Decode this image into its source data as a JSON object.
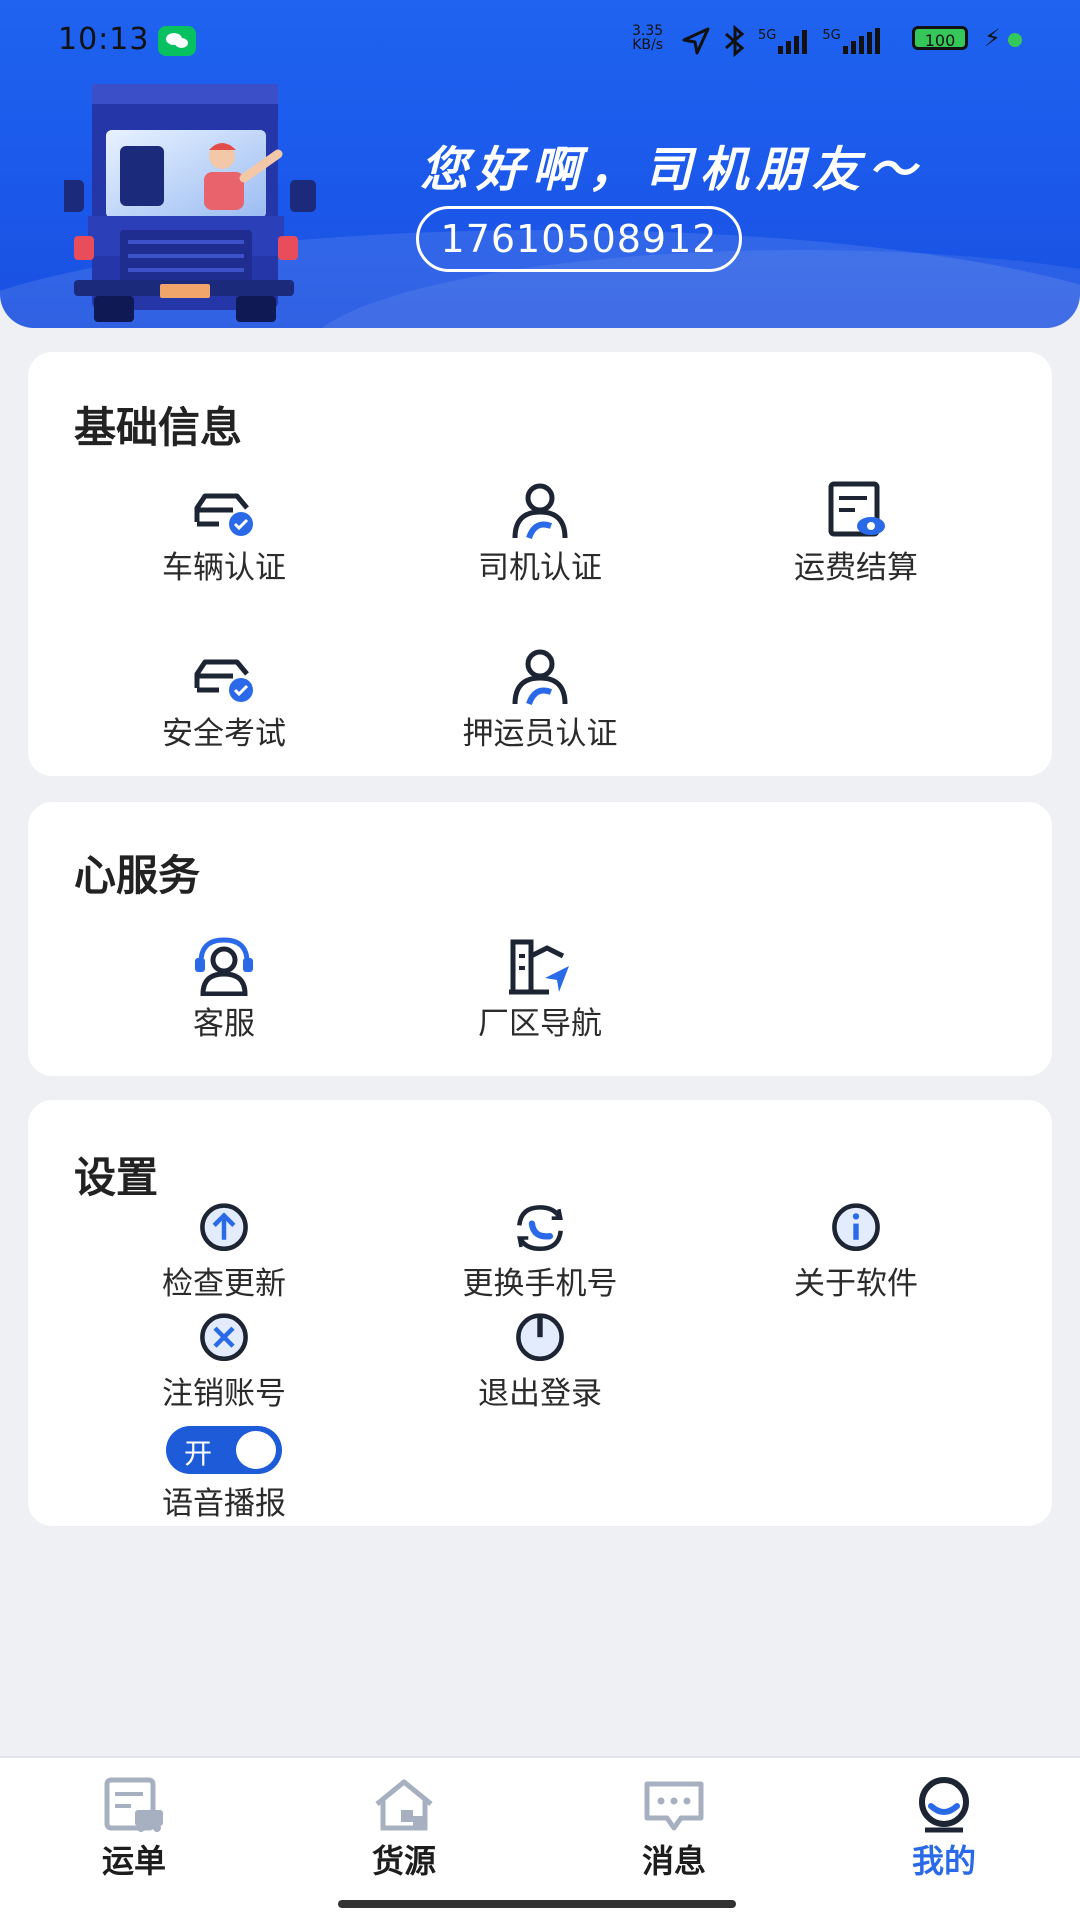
{
  "status_bar": {
    "time": "10:13",
    "net_speed_value": "3.35",
    "net_speed_unit": "KB/s",
    "network_1": "5G",
    "network_2": "5G",
    "battery": "100"
  },
  "header": {
    "greeting": "您好啊，司机朋友～",
    "phone": "17610508912"
  },
  "colors": {
    "brand_blue": "#1f63f0",
    "accent_blue": "#2a6ae8",
    "toggle_blue": "#1e5bd8"
  },
  "basic_info": {
    "title": "基础信息",
    "items": [
      {
        "label": "车辆认证",
        "icon": "car-check-icon"
      },
      {
        "label": "司机认证",
        "icon": "driver-icon"
      },
      {
        "label": "运费结算",
        "icon": "bill-eye-icon"
      },
      {
        "label": "安全考试",
        "icon": "car-check-icon"
      },
      {
        "label": "押运员认证",
        "icon": "driver-icon"
      }
    ]
  },
  "service": {
    "title": "心服务",
    "items": [
      {
        "label": "客服",
        "icon": "headset-icon"
      },
      {
        "label": "厂区导航",
        "icon": "factory-navigation-icon"
      }
    ]
  },
  "settings": {
    "title": "设置",
    "items": [
      {
        "label": "检查更新",
        "icon": "upload-arrow-icon"
      },
      {
        "label": "更换手机号",
        "icon": "phone-swap-icon"
      },
      {
        "label": "关于软件",
        "icon": "info-icon"
      },
      {
        "label": "注销账号",
        "icon": "close-circle-icon"
      },
      {
        "label": "退出登录",
        "icon": "power-icon"
      }
    ],
    "voice": {
      "label": "语音播报",
      "toggle_text": "开",
      "enabled": true
    }
  },
  "bottom_nav": {
    "items": [
      {
        "label": "运单",
        "icon": "waybill-icon",
        "active": false
      },
      {
        "label": "货源",
        "icon": "goods-home-icon",
        "active": false
      },
      {
        "label": "消息",
        "icon": "message-icon",
        "active": false
      },
      {
        "label": "我的",
        "icon": "profile-icon",
        "active": true
      }
    ]
  }
}
